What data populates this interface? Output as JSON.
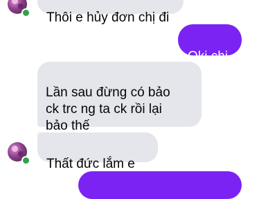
{
  "messages": [
    {
      "direction": "incoming",
      "text": "Thôi e hủy đơn chị đi"
    },
    {
      "direction": "outgoing",
      "text": "Oki chị"
    },
    {
      "direction": "incoming",
      "text": "Lần sau đừng có bảo\nck trc ng ta ck rồi lại\nbảo thế"
    },
    {
      "direction": "incoming",
      "text": "Thất đức lắm e"
    },
    {
      "direction": "outgoing",
      "text": ""
    }
  ],
  "colors": {
    "incoming_bubble": "#e4e6eb",
    "outgoing_bubble": "#7b23f2",
    "online_indicator": "#31a24c"
  }
}
